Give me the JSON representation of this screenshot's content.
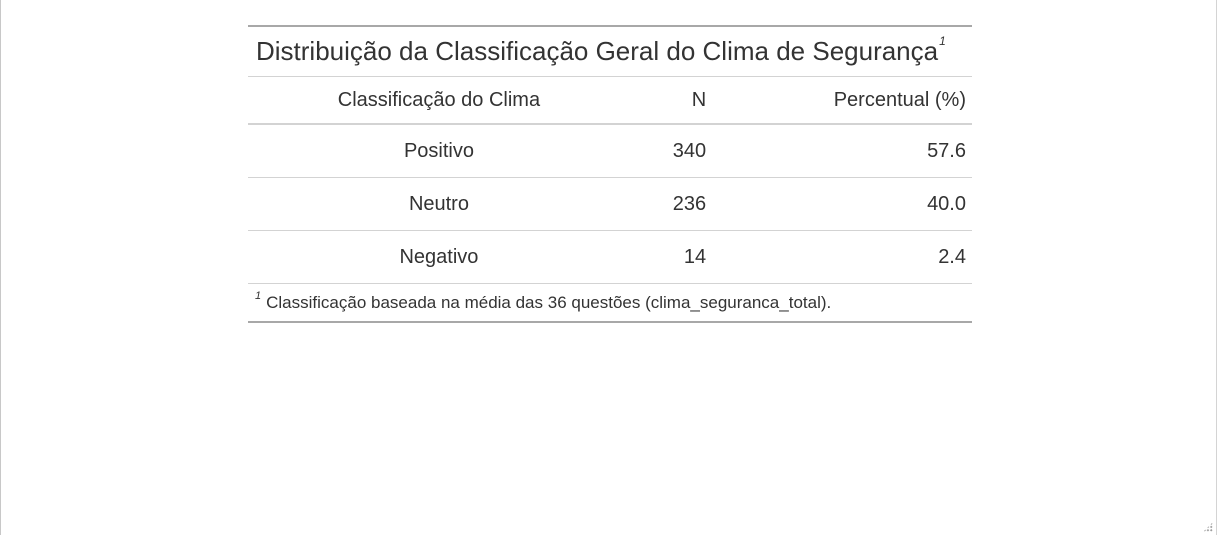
{
  "table": {
    "title": "Distribuição da Classificação Geral do Clima de Segurança",
    "title_footnote_mark": "1",
    "columns": [
      "Classificação do Clima",
      "N",
      "Percentual (%)"
    ],
    "rows": [
      {
        "classification": "Positivo",
        "n": "340",
        "percent": "57.6"
      },
      {
        "classification": "Neutro",
        "n": "236",
        "percent": "40.0"
      },
      {
        "classification": "Negativo",
        "n": "14",
        "percent": "2.4"
      }
    ],
    "footnote": {
      "mark": "1",
      "text": "Classificação baseada na média das 36 questões (clima_seguranca_total)."
    }
  },
  "colors": {
    "text": "#333333",
    "outer_rule": "#a8a8a8",
    "inner_rule": "#d3d3d3",
    "background": "#ffffff"
  }
}
